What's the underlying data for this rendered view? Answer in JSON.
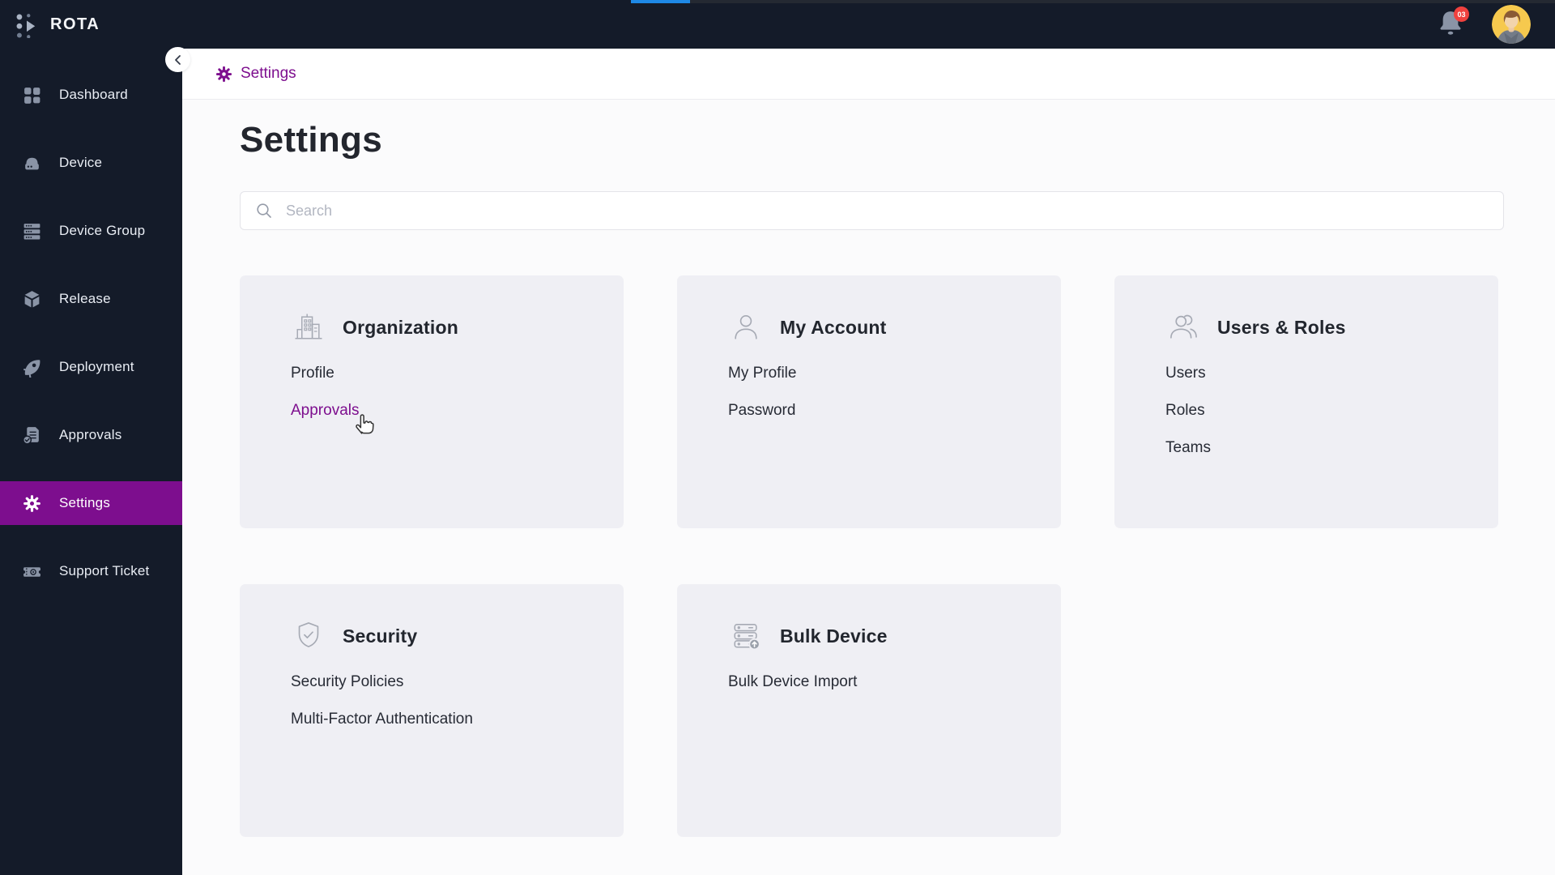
{
  "app": {
    "name": "ROTA"
  },
  "topbar": {
    "notification_badge": "03"
  },
  "sidebar": {
    "items": [
      {
        "label": "Dashboard",
        "active": false
      },
      {
        "label": "Device",
        "active": false
      },
      {
        "label": "Device Group",
        "active": false
      },
      {
        "label": "Release",
        "active": false
      },
      {
        "label": "Deployment",
        "active": false
      },
      {
        "label": "Approvals",
        "active": false
      },
      {
        "label": "Settings",
        "active": true
      },
      {
        "label": "Support Ticket",
        "active": false
      }
    ]
  },
  "breadcrumb": {
    "label": "Settings"
  },
  "page": {
    "title": "Settings"
  },
  "search": {
    "placeholder": "Search"
  },
  "cards": [
    {
      "title": "Organization",
      "links": [
        {
          "label": "Profile"
        },
        {
          "label": "Approvals"
        }
      ]
    },
    {
      "title": "My Account",
      "links": [
        {
          "label": "My Profile"
        },
        {
          "label": "Password"
        }
      ]
    },
    {
      "title": "Users & Roles",
      "links": [
        {
          "label": "Users"
        },
        {
          "label": "Roles"
        },
        {
          "label": "Teams"
        }
      ]
    },
    {
      "title": "Security",
      "links": [
        {
          "label": "Security Policies"
        },
        {
          "label": "Multi-Factor Authentication"
        }
      ]
    },
    {
      "title": "Bulk Device",
      "links": [
        {
          "label": "Bulk Device Import"
        }
      ]
    }
  ],
  "colors": {
    "accent_purple": "#7D0E8E",
    "navy": "#141B29",
    "badge_red": "#F0413E",
    "tab_blue": "#1E88E5",
    "icon_gray": "#8A94A6",
    "card_bg": "#EFEFF4"
  }
}
